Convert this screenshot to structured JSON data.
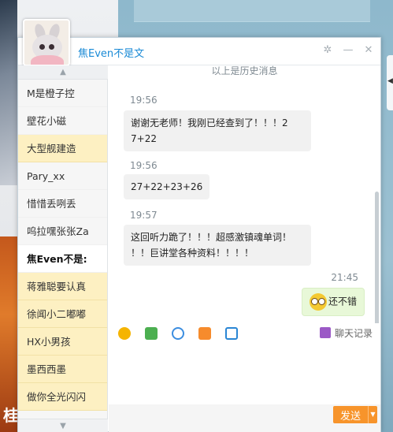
{
  "window": {
    "title": "焦Even不是文",
    "controls": [
      "settings",
      "minimize",
      "close"
    ]
  },
  "contacts": {
    "items": [
      {
        "name": "M是橙子控",
        "state": "normal"
      },
      {
        "name": "壁花小磁",
        "state": "normal"
      },
      {
        "name": "大型舰建造",
        "state": "highlight"
      },
      {
        "name": "Pary_xx",
        "state": "normal"
      },
      {
        "name": "惜惜丢咧丢",
        "state": "normal"
      },
      {
        "name": "呜拉嘿张张Za",
        "state": "normal"
      },
      {
        "name": "焦Even不是:",
        "state": "selected"
      },
      {
        "name": "蒋雅聪要认真",
        "state": "highlight"
      },
      {
        "name": "徐闻小二嘟嘟",
        "state": "highlight"
      },
      {
        "name": "HX小男孩",
        "state": "highlight"
      },
      {
        "name": "墨西西墨",
        "state": "highlight"
      },
      {
        "name": "做你全光闪闪",
        "state": "highlight"
      }
    ]
  },
  "messages": {
    "history_notice": "以上是历史消息",
    "items": [
      {
        "time": "19:56",
        "text_lines": [
          "谢谢无老师！我刚已经查到了！！！2",
          "7+22"
        ],
        "from": "them"
      },
      {
        "time": "19:56",
        "text_lines": [
          "27+22+23+26"
        ],
        "from": "them"
      },
      {
        "time": "19:57",
        "text_lines": [
          "这回听力跪了！！！超感激镇魂单词！",
          "！！巨讲堂各种资料！！！！"
        ],
        "from": "them"
      },
      {
        "time": "21:45",
        "text_lines": [
          "还不错"
        ],
        "from": "me",
        "emoji": "smile-emoji"
      }
    ]
  },
  "toolbar": {
    "icons": [
      "emoji-icon",
      "image-icon",
      "attachment-icon",
      "screenshot-icon",
      "feedback-icon"
    ],
    "history_label": "聊天记录"
  },
  "footer": {
    "send_label": "发送"
  },
  "colors": {
    "title": "#1a8ad6",
    "send": "#f7942b",
    "contact_highlight": "#fdf0c2",
    "my_bubble": "#e8f8d8"
  }
}
